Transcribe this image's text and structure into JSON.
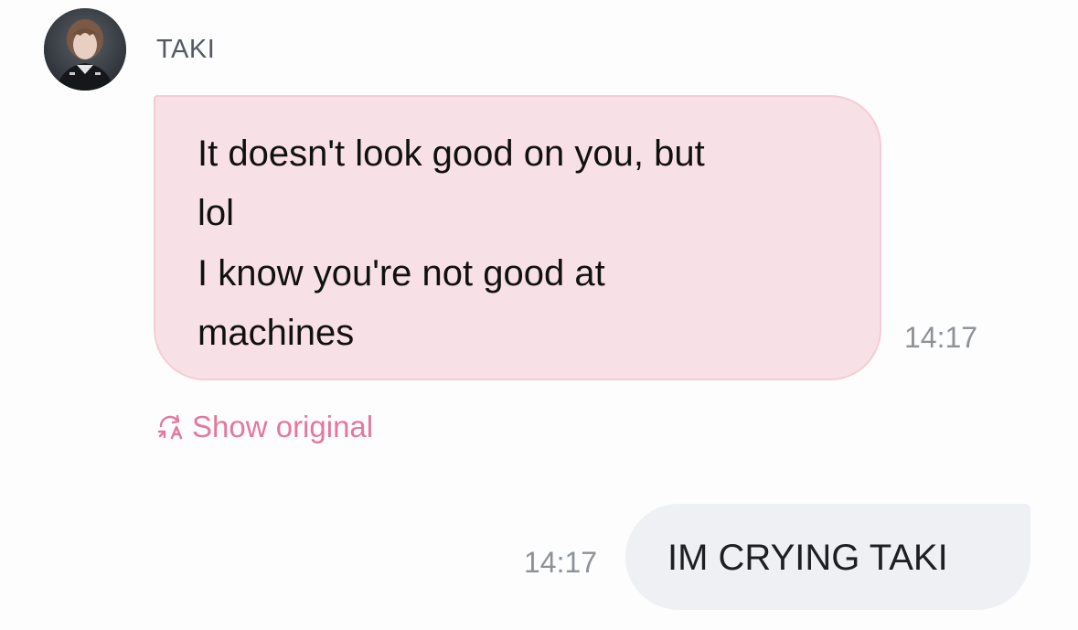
{
  "incoming": {
    "sender_name": "TAKI",
    "avatar_icon": "profile-photo",
    "lines": [
      "It doesn't look good on you, but",
      "lol",
      "I know you're not good at",
      "machines"
    ],
    "time": "14:17",
    "bubble_color": "#f8e1e6",
    "show_original_label": "Show original",
    "show_original_icon": "translate-refresh-icon",
    "accent_color": "#e4789a"
  },
  "outgoing": {
    "text": "IM CRYING TAKI",
    "time": "14:17",
    "bubble_color": "#eff0f3"
  }
}
